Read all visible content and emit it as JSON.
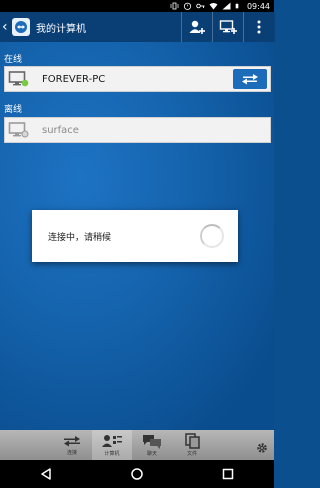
{
  "status_bar": {
    "time": "09:44",
    "icons": [
      "vibrate-icon",
      "alarm-icon",
      "key-icon",
      "wifi-icon",
      "signal-icon",
      "battery-icon"
    ]
  },
  "action_bar": {
    "title": "我的计算机",
    "buttons": [
      "add-contact-icon",
      "add-computer-icon",
      "overflow-menu-icon"
    ]
  },
  "online_section": {
    "label": "在线",
    "computers": [
      {
        "name": "FOREVER-PC",
        "status": "online"
      }
    ]
  },
  "offline_section": {
    "label": "离线",
    "computers": [
      {
        "name": "surface",
        "status": "offline"
      }
    ]
  },
  "dialog": {
    "message": "连接中，请稍候"
  },
  "tab_bar": {
    "tabs": [
      {
        "label": "连接",
        "icon": "connect-icon",
        "active": false
      },
      {
        "label": "计算机",
        "icon": "computers-icon",
        "active": true
      },
      {
        "label": "聊天",
        "icon": "chat-icon",
        "active": false
      },
      {
        "label": "文件",
        "icon": "files-icon",
        "active": false
      }
    ],
    "settings_icon": "settings-icon"
  },
  "nav_bar": {
    "buttons": [
      "back-triangle-icon",
      "home-circle-icon",
      "recents-square-icon"
    ]
  },
  "colors": {
    "action_bar": "#0a3f76",
    "background": "#1563ad",
    "accent": "#1d6cb9",
    "online_dot": "#7ac943"
  }
}
